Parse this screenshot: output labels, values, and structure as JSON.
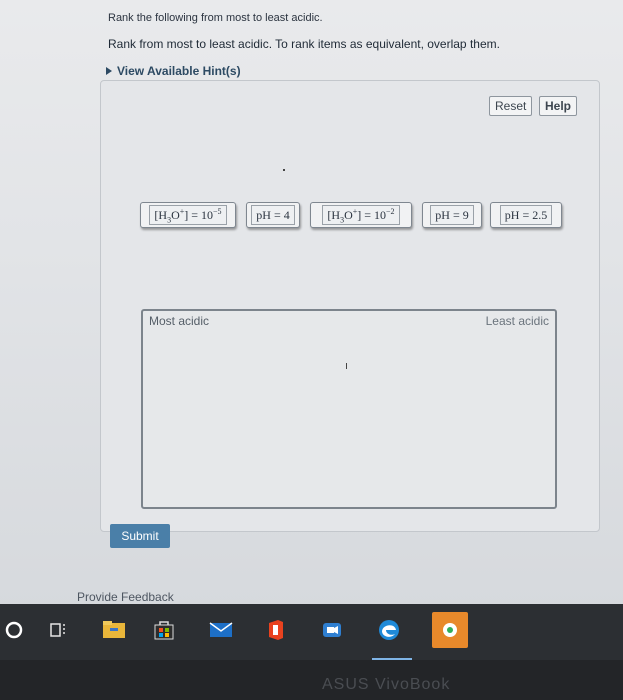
{
  "question": {
    "line1": "Rank the following from most to least acidic.",
    "line2": "Rank from most to least acidic. To rank items as equivalent, overlap them."
  },
  "hint": {
    "label": "View Available Hint(s)"
  },
  "toolbar": {
    "reset_label": "Reset",
    "help_label": "Help"
  },
  "tiles": [
    {
      "prefix": "[H",
      "sub": "3",
      "mid": "O",
      "sup1": "+",
      "suffix": "] = 10",
      "exp": "−5"
    },
    {
      "text": "pH = 4"
    },
    {
      "prefix": "[H",
      "sub": "3",
      "mid": "O",
      "sup1": "+",
      "suffix": "] = 10",
      "exp": "−2"
    },
    {
      "text": "pH = 9"
    },
    {
      "text": "pH = 2.5"
    }
  ],
  "ranking": {
    "most_label": "Most acidic",
    "least_label": "Least acidic"
  },
  "submit_label": "Submit",
  "feedback_label": "Provide Feedback",
  "brand": "ASUS VivoBook",
  "colors": {
    "submit_bg": "#4a7fa8",
    "taskbar_bg": "#2c2f33",
    "hint_color": "#2d4a63"
  },
  "taskbar_icons": [
    "search-circle-icon",
    "task-view-icon",
    "file-explorer-icon",
    "store-icon",
    "mail-icon",
    "office-icon",
    "teams-icon",
    "edge-icon",
    "app-icon"
  ]
}
